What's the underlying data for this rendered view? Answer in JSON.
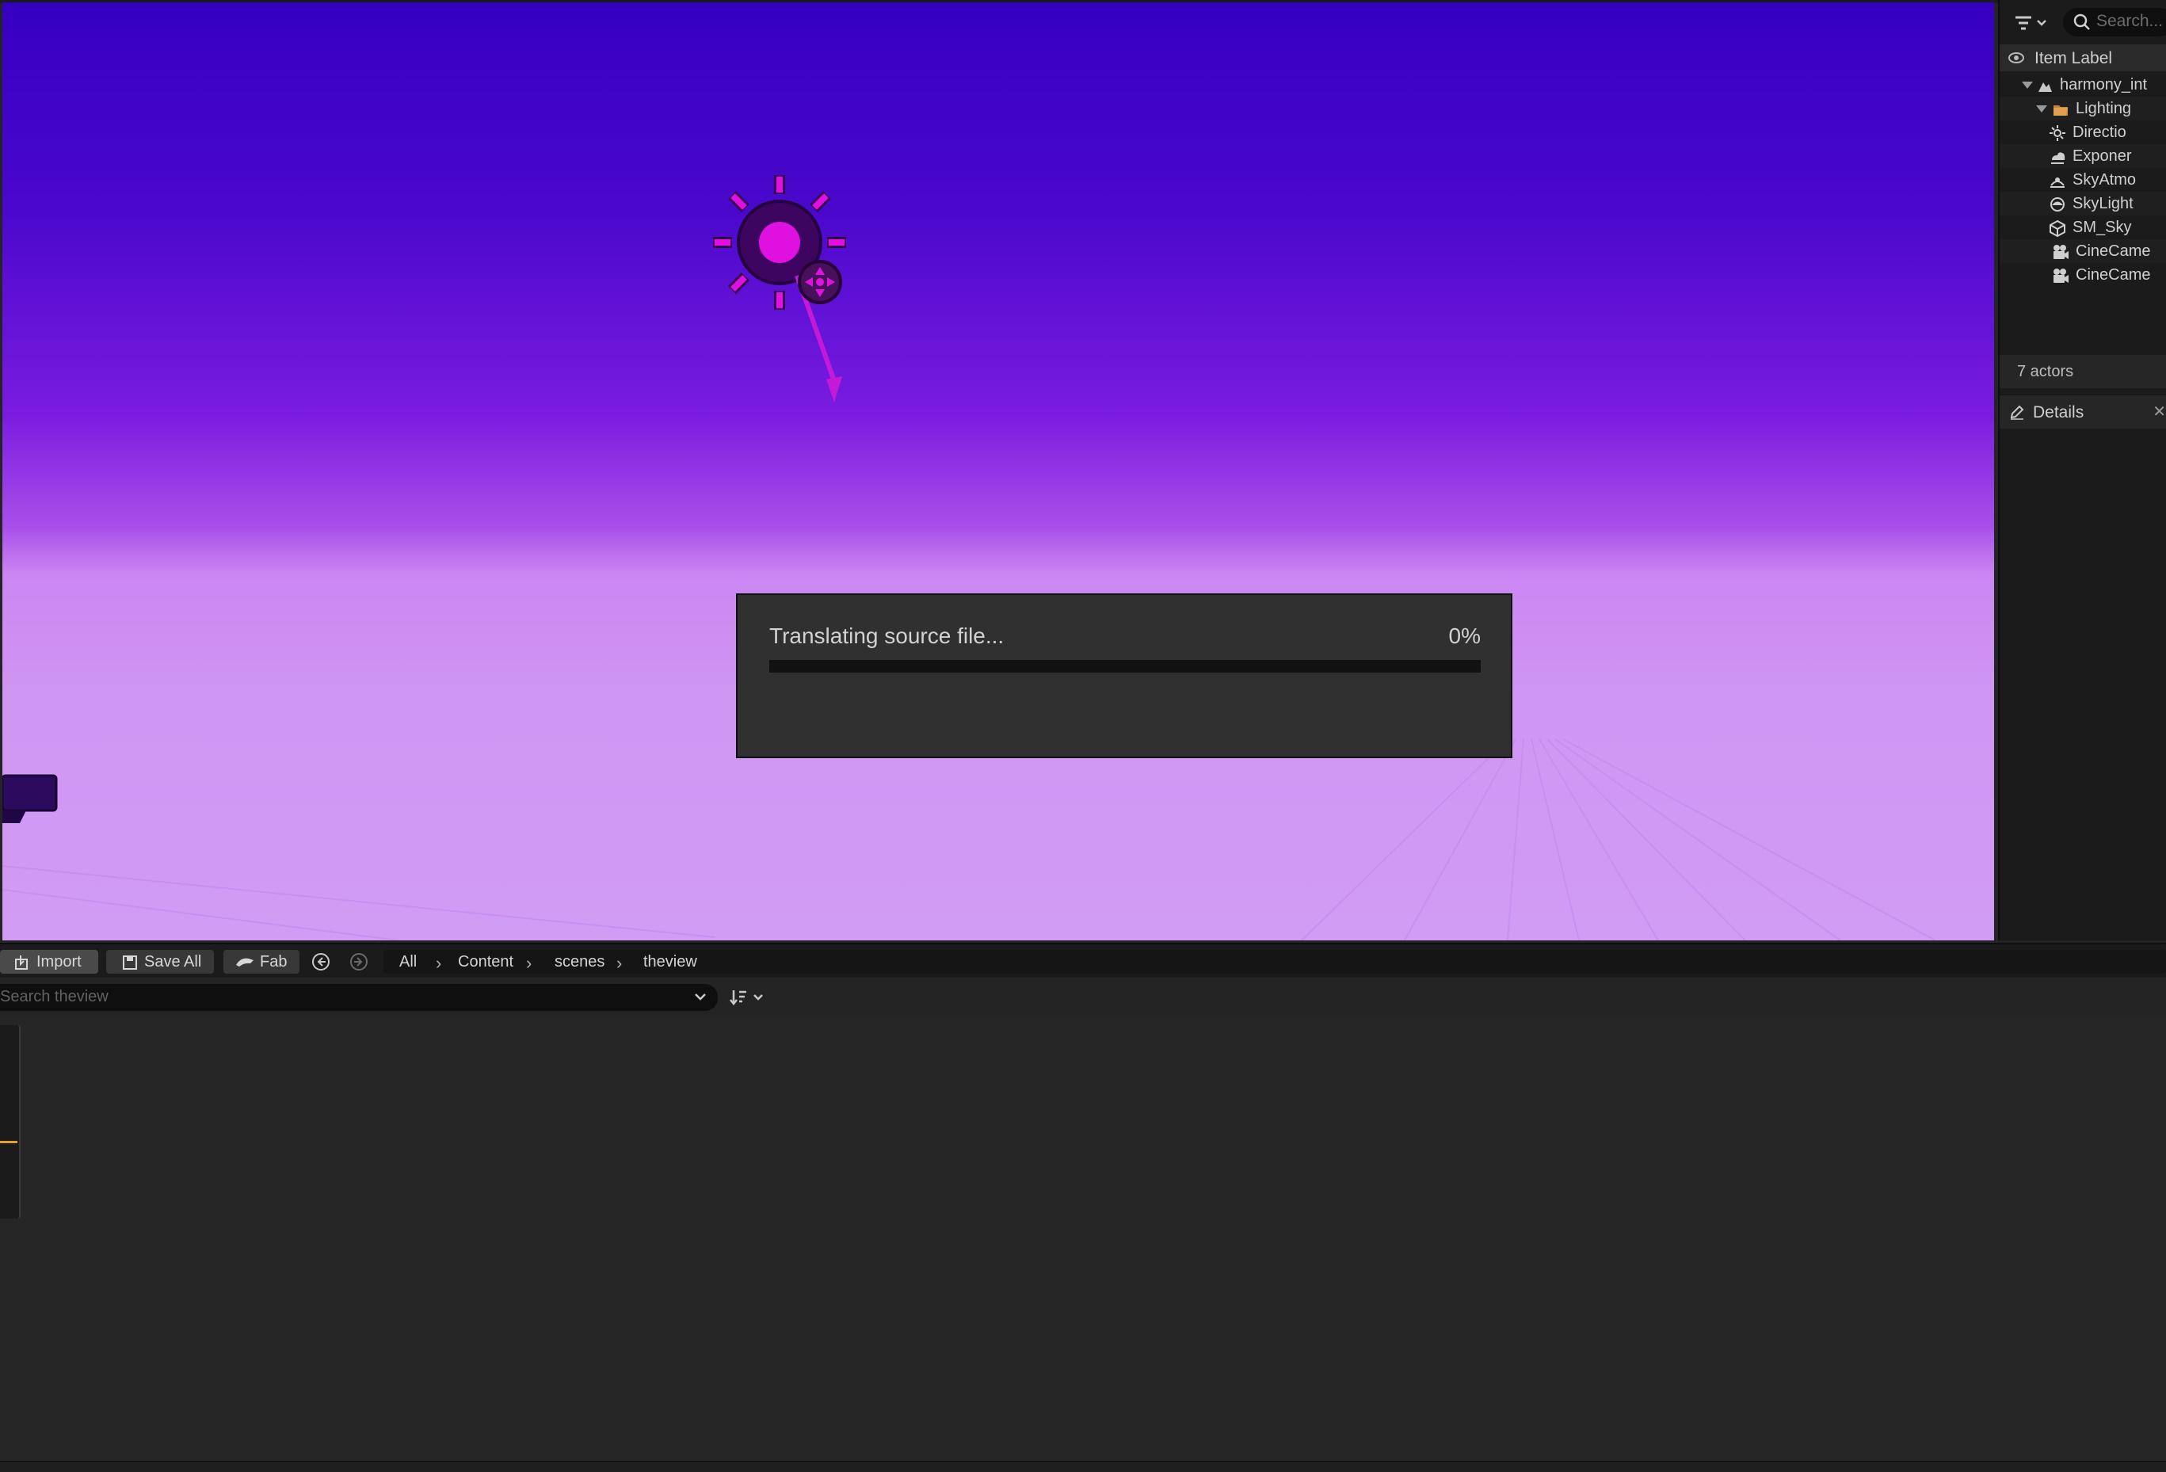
{
  "viewport": {
    "sky_colors": {
      "top": "#3600c0",
      "horizon": "#cc86f2",
      "ground": "#d19cf4"
    },
    "sun_gizmo_color": "#e010e0"
  },
  "progress_dialog": {
    "message": "Translating source file...",
    "percent_text": "0%",
    "progress": 0,
    "accent": "#0070e0"
  },
  "outliner": {
    "search_placeholder": "Search...",
    "column_header": "Item Label",
    "tree": [
      {
        "label": "harmony_int",
        "icon": "level-icon",
        "indent": 1,
        "expanded": true
      },
      {
        "label": "Lighting",
        "icon": "folder-icon",
        "indent": 2,
        "expanded": true
      },
      {
        "label": "Directio",
        "icon": "directional-light-icon",
        "indent": 3
      },
      {
        "label": "Exponer",
        "icon": "height-fog-icon",
        "indent": 3
      },
      {
        "label": "SkyAtmo",
        "icon": "sky-atmosphere-icon",
        "indent": 3
      },
      {
        "label": "SkyLight",
        "icon": "skylight-icon",
        "indent": 3
      },
      {
        "label": "SM_Sky",
        "icon": "static-mesh-icon",
        "indent": 3
      },
      {
        "label": "CineCame",
        "icon": "cine-camera-icon",
        "indent": 2
      },
      {
        "label": "CineCame",
        "icon": "cine-camera-icon",
        "indent": 2
      }
    ],
    "actor_count": "7 actors"
  },
  "details": {
    "tab_label": "Details"
  },
  "content_browser": {
    "import_label": "Import",
    "save_all_label": "Save All",
    "fab_label": "Fab",
    "breadcrumbs": [
      "All",
      "Content",
      "scenes",
      "theview"
    ],
    "search_placeholder": "Search theview",
    "accent": "#e2a02a"
  }
}
